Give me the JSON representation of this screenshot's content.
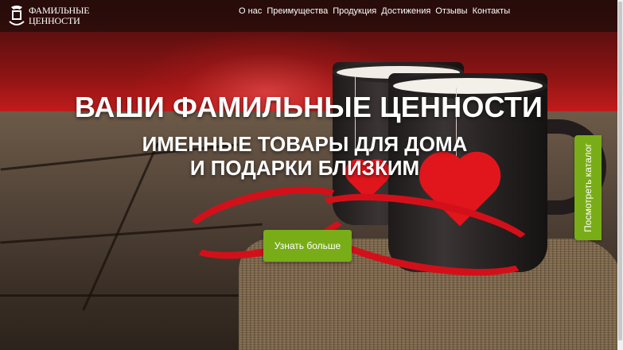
{
  "brand": {
    "line1": "ФАМИЛЬНЫЕ",
    "line2": "ЦЕННОСТИ"
  },
  "nav": {
    "items": [
      "О нас",
      "Преимущества",
      "Продукция",
      "Достижения",
      "Отзывы",
      "Контакты"
    ]
  },
  "hero": {
    "title": "ВАШИ ФАМИЛЬНЫЕ ЦЕННОСТИ",
    "subtitle_line1": "ИМЕННЫЕ ТОВАРЫ ДЛЯ ДОМА",
    "subtitle_line2": "И ПОДАРКИ БЛИЗКИМ",
    "cta_label": "Узнать больше",
    "catalog_label": "Посмотреть каталог"
  },
  "colors": {
    "accent": "#79ad18",
    "nav_bg": "#1e0c0a",
    "heart": "#e0161c"
  },
  "icons": {
    "logo": "family-crest-logo-icon"
  }
}
